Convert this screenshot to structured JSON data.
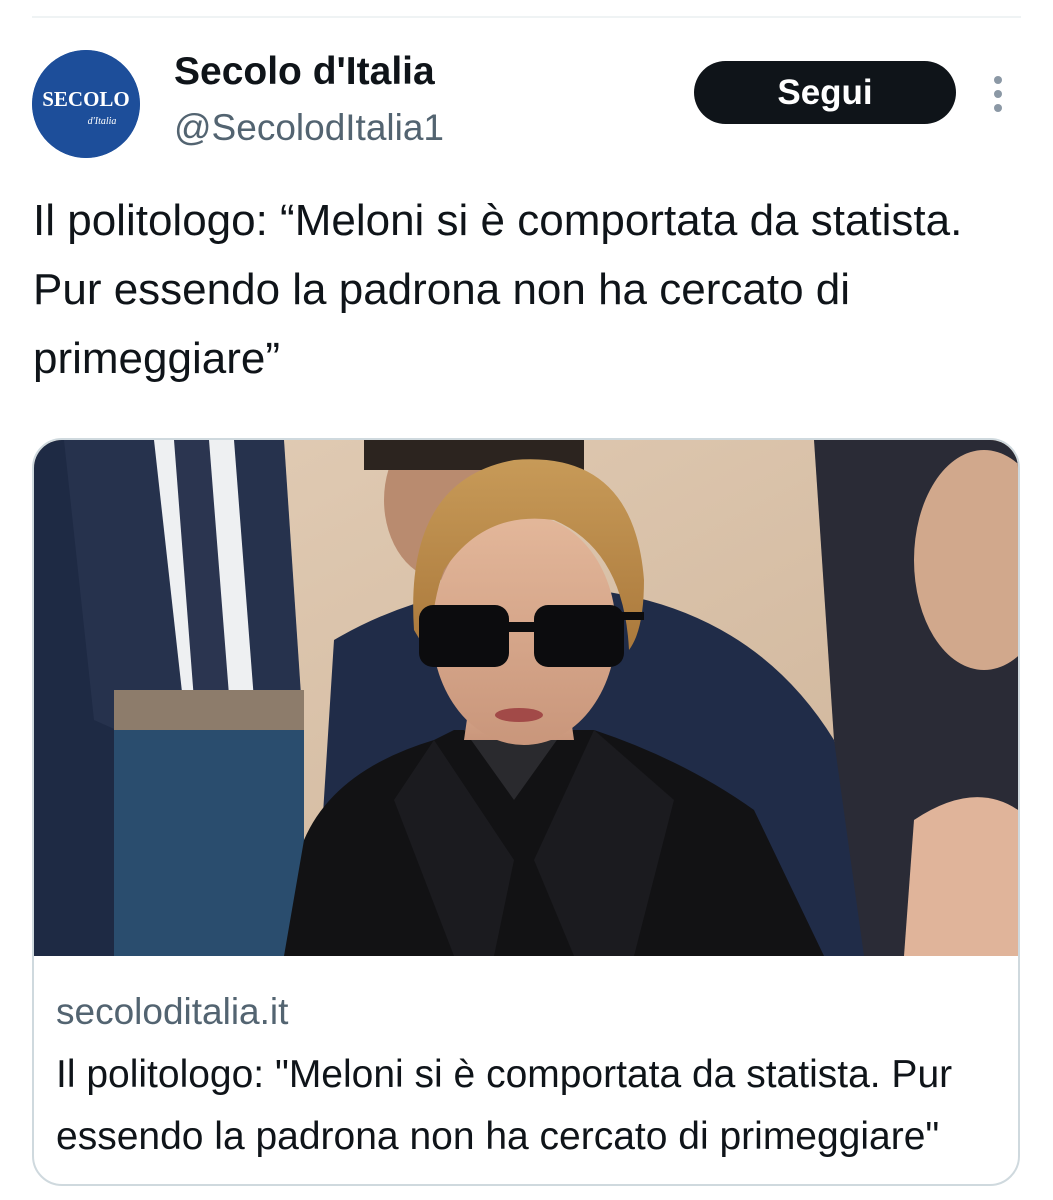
{
  "account": {
    "name": "Secolo d'Italia",
    "handle": "@SecolodItalia1",
    "avatar_logo_text": "SECOLO",
    "avatar_logo_subtext": "d'Italia",
    "avatar_color": "#1d4e9a"
  },
  "actions": {
    "follow_label": "Segui",
    "more_icon": "more-vertical-icon"
  },
  "tweet": {
    "text": "Il politologo: “Meloni si è comportata da statista. Pur essendo la padrona non ha cercato di primeggiare”"
  },
  "link_card": {
    "domain": "secoloditalia.it",
    "title": "Il politologo: \"Meloni si è comportata da statista. Pur essendo la padrona non ha cercato di primeggiare\"",
    "image": "photo of a woman with blonde hair and dark sunglasses in a black jacket, surrounded by men in suits"
  },
  "colors": {
    "text_primary": "#0f1419",
    "text_secondary": "#536471",
    "border": "#cfd9de",
    "button_bg": "#0f1419",
    "button_text": "#ffffff"
  }
}
